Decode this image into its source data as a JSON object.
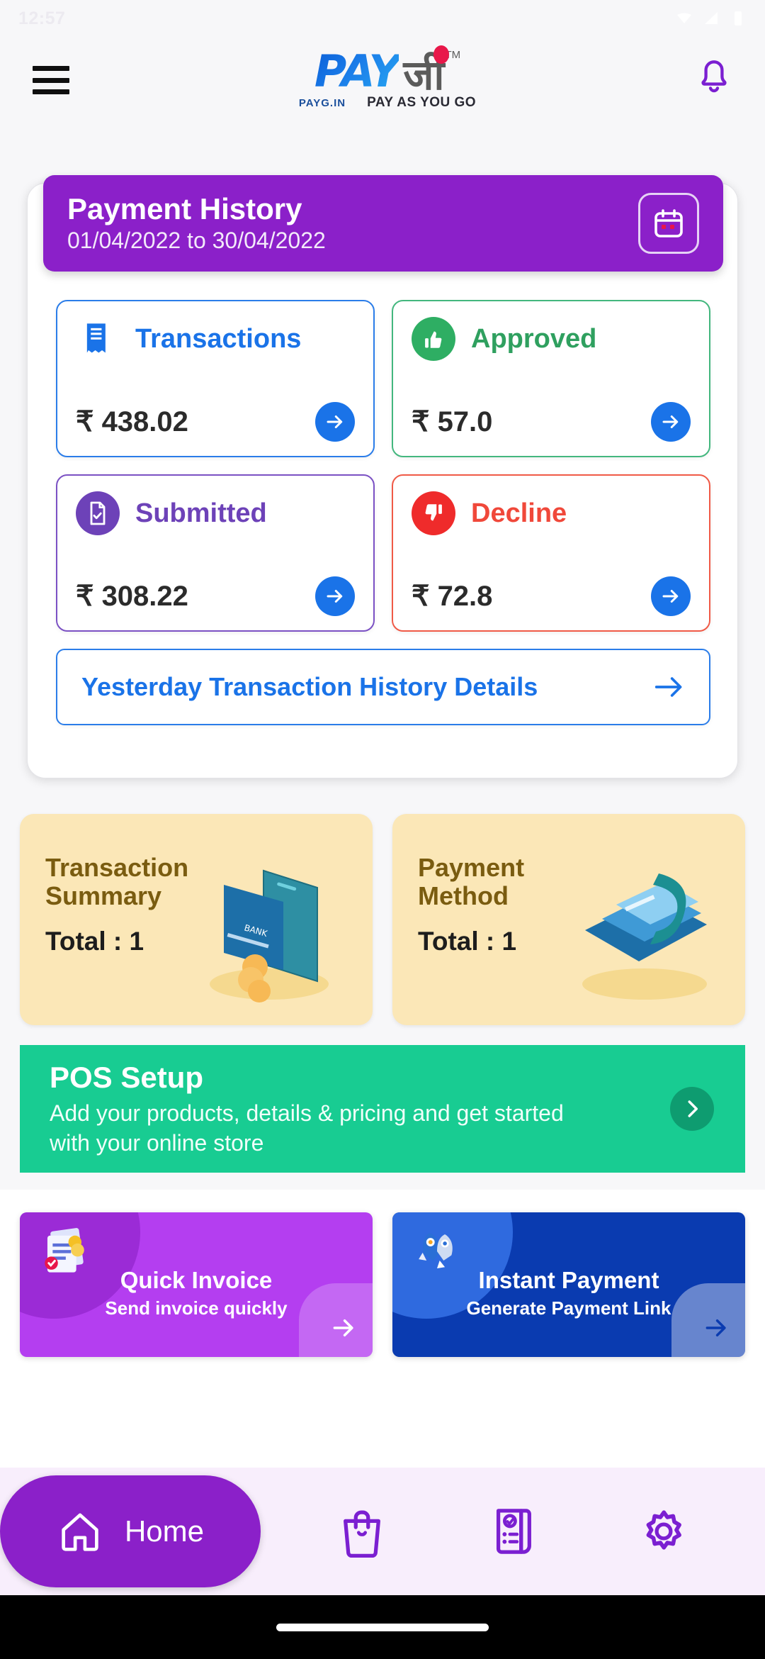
{
  "status_bar": {
    "time": "12:57",
    "icons": [
      "wifi-icon",
      "signal-icon",
      "battery-icon"
    ]
  },
  "header": {
    "menu_icon": "hamburger-menu-icon",
    "notification_icon": "bell-icon",
    "logo": {
      "primary": "PAY",
      "hindi": "जी",
      "trademark": "TM",
      "domain": "PAYG.IN",
      "tagline": "PAY AS YOU GO"
    }
  },
  "payment_history": {
    "title": "Payment History",
    "date_range": "01/04/2022 to 30/04/2022",
    "calendar_icon": "calendar-icon",
    "tiles": [
      {
        "label": "Transactions",
        "amount": "₹ 438.02",
        "icon": "receipt-icon",
        "color": "#1a73e8",
        "variant": "blue"
      },
      {
        "label": "Approved",
        "amount": "₹ 57.0",
        "icon": "thumbs-up-icon",
        "color": "#2fa05f",
        "variant": "green"
      },
      {
        "label": "Submitted",
        "amount": "₹ 308.22",
        "icon": "document-check-icon",
        "color": "#6d42b8",
        "variant": "purple"
      },
      {
        "label": "Decline",
        "amount": "₹ 72.8",
        "icon": "thumbs-down-icon",
        "color": "#f0483a",
        "variant": "red"
      }
    ],
    "yesterday_link": "Yesterday Transaction History Details"
  },
  "summary_cards": [
    {
      "title": "Transaction Summary",
      "total": "Total : 1",
      "art": "phone-card-coins-illustration"
    },
    {
      "title": "Payment Method",
      "total": "Total : 1",
      "art": "cards-payment-illustration"
    }
  ],
  "pos_banner": {
    "title": "POS Setup",
    "description": "Add your products, details & pricing and get started with your online store",
    "arrow_icon": "chevron-right-icon",
    "color": "#18cc92"
  },
  "quick_actions": [
    {
      "title": "Quick Invoice",
      "subtitle": "Send invoice quickly",
      "icon": "invoice-document-icon",
      "color": "#b43ef0",
      "variant": "purple"
    },
    {
      "title": "Instant Payment",
      "subtitle": "Generate Payment Link",
      "icon": "rocket-icon",
      "color": "#0a3bb0",
      "variant": "blue"
    }
  ],
  "bottom_nav": {
    "active": "Home",
    "items": [
      {
        "label": "Home",
        "icon": "home-icon",
        "active": true
      },
      {
        "label": "",
        "icon": "shopping-bag-icon",
        "active": false
      },
      {
        "label": "",
        "icon": "invoice-list-icon",
        "active": false
      },
      {
        "label": "",
        "icon": "gear-icon",
        "active": false
      }
    ],
    "accent": "#8b20c9"
  }
}
